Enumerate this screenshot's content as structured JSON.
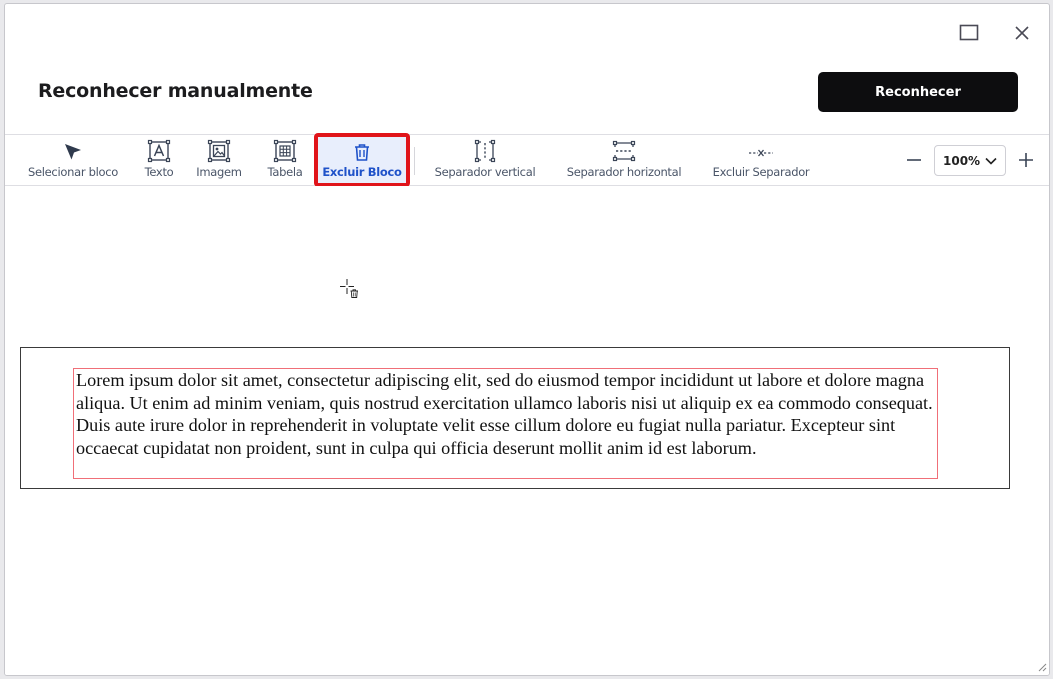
{
  "dialog": {
    "title": "Reconhecer manualmente",
    "primary_button": "Reconhecer"
  },
  "toolbar": {
    "tools": [
      {
        "label": "Selecionar bloco",
        "icon": "cursor-arrow-icon"
      },
      {
        "label": "Texto",
        "icon": "text-block-icon"
      },
      {
        "label": "Imagem",
        "icon": "image-block-icon"
      },
      {
        "label": "Tabela",
        "icon": "table-block-icon"
      },
      {
        "label": "Excluir Bloco",
        "icon": "trash-icon",
        "active": true
      },
      {
        "label": "Separador vertical",
        "icon": "vertical-separator-icon"
      },
      {
        "label": "Separador horizontal",
        "icon": "horizontal-separator-icon"
      },
      {
        "label": "Excluir Separador",
        "icon": "delete-separator-icon"
      }
    ],
    "zoom": "100%"
  },
  "document": {
    "text": "Lorem ipsum dolor sit amet, consectetur adipiscing elit, sed do eiusmod tempor incididunt ut labore et dolore magna aliqua. Ut enim ad minim veniam, quis nostrud exercitation ullamco laboris nisi ut aliquip ex ea commodo consequat. Duis aute irure dolor in reprehenderit in voluptate velit esse cillum dolore eu fugiat nulla pariatur. Excepteur sint occaecat cupidatat non proident, sunt in culpa qui officia deserunt mollit anim id est laborum."
  },
  "colors": {
    "accent": "#1f52c9",
    "highlight": "#e0141a",
    "text_block_border": "#f06f78",
    "primary_button_bg": "#0d0d0f"
  }
}
